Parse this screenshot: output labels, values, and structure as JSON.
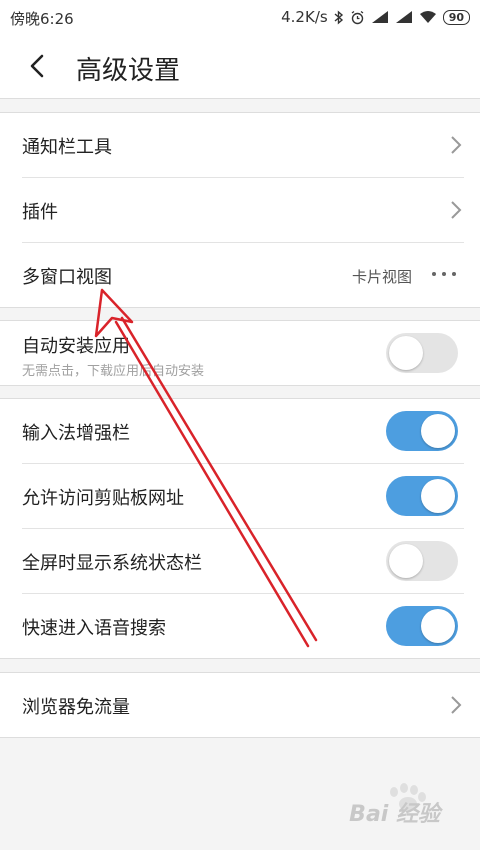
{
  "status_bar": {
    "time": "傍晚6:26",
    "speed": "4.2K/s",
    "battery": "90"
  },
  "header": {
    "title": "高级设置"
  },
  "groups": [
    {
      "rows": [
        {
          "label": "通知栏工具",
          "control": "chevron"
        },
        {
          "label": "插件",
          "control": "chevron"
        },
        {
          "label": "多窗口视图",
          "value": "卡片视图",
          "control": "more"
        }
      ]
    },
    {
      "rows": [
        {
          "label": "自动安装应用",
          "subtitle": "无需点击，下载应用后自动安装",
          "control": "toggle",
          "on": false
        }
      ]
    },
    {
      "rows": [
        {
          "label": "输入法增强栏",
          "control": "toggle",
          "on": true
        },
        {
          "label": "允许访问剪贴板网址",
          "control": "toggle",
          "on": true
        },
        {
          "label": "全屏时显示系统状态栏",
          "control": "toggle",
          "on": false
        },
        {
          "label": "快速进入语音搜索",
          "control": "toggle",
          "on": true
        }
      ]
    },
    {
      "rows": [
        {
          "label": "浏览器免流量",
          "control": "chevron"
        }
      ]
    }
  ],
  "watermark": {
    "text": "Bai 经验"
  },
  "colors": {
    "toggle_on": "#4d9ee0",
    "toggle_off": "#e4e4e4",
    "annotation_arrow": "#d9232a"
  }
}
